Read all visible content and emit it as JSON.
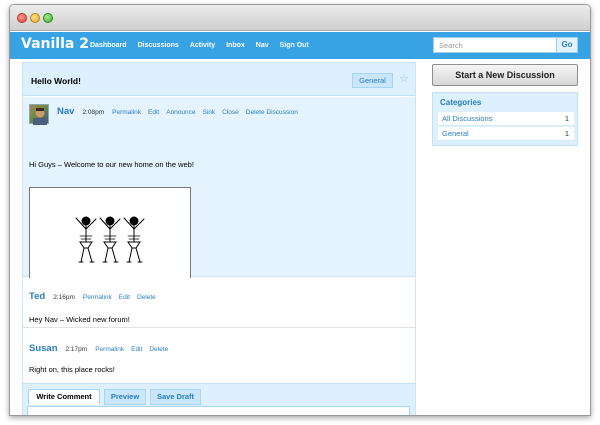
{
  "header": {
    "brand": "Vanilla 2",
    "nav": [
      "Dashboard",
      "Discussions",
      "Activity",
      "Inbox",
      "Nav",
      "Sign Out"
    ],
    "search_placeholder": "Search",
    "go_label": "Go"
  },
  "discussion": {
    "title": "Hello World!",
    "category": "General"
  },
  "posts": [
    {
      "author": "Nav",
      "time": "2:08pm",
      "actions": [
        "Permalink",
        "Edit",
        "Announce",
        "Sink",
        "Close",
        "Delete Discussion"
      ],
      "body": "Hi Guys – Welcome to our new home on the web!"
    },
    {
      "author": "Ted",
      "time": "2:16pm",
      "actions": [
        "Permalink",
        "Edit",
        "Delete"
      ],
      "body": "Hey Nav – Wicked new forum!"
    },
    {
      "author": "Susan",
      "time": "2:17pm",
      "actions": [
        "Permalink",
        "Edit",
        "Delete"
      ],
      "body": "Right on, this place rocks!"
    }
  ],
  "comment_tabs": [
    "Write Comment",
    "Preview",
    "Save Draft"
  ],
  "sidebar": {
    "new_discussion_label": "Start a New Discussion",
    "categories_heading": "Categories",
    "categories": [
      {
        "name": "All Discussions",
        "count": "1"
      },
      {
        "name": "General",
        "count": "1"
      }
    ]
  },
  "colors": {
    "brand_blue": "#37a3e5",
    "link_blue": "#2a7fc0",
    "panel_blue": "#dcf0fd"
  }
}
